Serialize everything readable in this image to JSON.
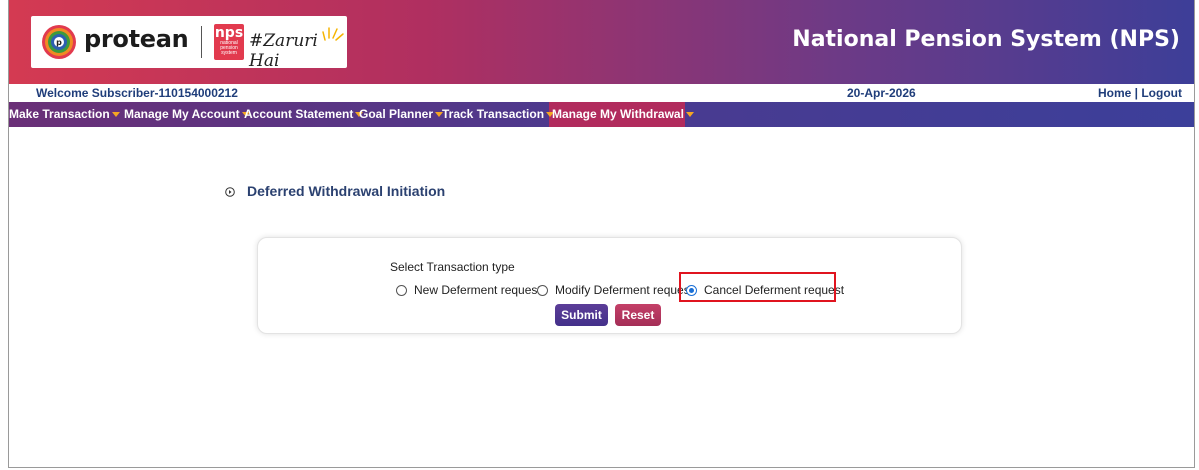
{
  "header": {
    "brand_name": "protean",
    "nps_badge_text": "nps",
    "nps_badge_subtext": "national pension system",
    "tagline": "#Zaruri Hai",
    "site_title": "National Pension System (NPS)"
  },
  "welcome_bar": {
    "welcome_text": "Welcome Subscriber-110154000212",
    "date": "20-Apr-2026",
    "home_link": "Home",
    "separator": " | ",
    "logout_link": "Logout"
  },
  "nav": {
    "items": [
      {
        "label": "Make Transaction"
      },
      {
        "label": "Manage My Account"
      },
      {
        "label": "Account Statement"
      },
      {
        "label": "Goal Planner"
      },
      {
        "label": "Track Transaction"
      },
      {
        "label": "Manage My Withdrawal"
      }
    ],
    "active_index": 5
  },
  "main": {
    "heading": "Deferred Withdrawal Initiation",
    "select_label": "Select Transaction type",
    "options": [
      {
        "label": "New Deferment request",
        "checked": false
      },
      {
        "label": "Modify Deferment request",
        "checked": false
      },
      {
        "label": "Cancel Deferment request",
        "checked": true
      }
    ],
    "submit_label": "Submit",
    "reset_label": "Reset"
  },
  "colors": {
    "banner_start": "#d43a52",
    "banner_end": "#3d3e98",
    "nav_active": "#b12b5d",
    "heading": "#2b4170",
    "highlight": "#e0141f",
    "caret": "#f5a623"
  },
  "icons": {
    "emblem": "protean-emblem-icon",
    "heading_bullet": "circle-arrow-right-icon",
    "caret": "caret-down-icon"
  }
}
